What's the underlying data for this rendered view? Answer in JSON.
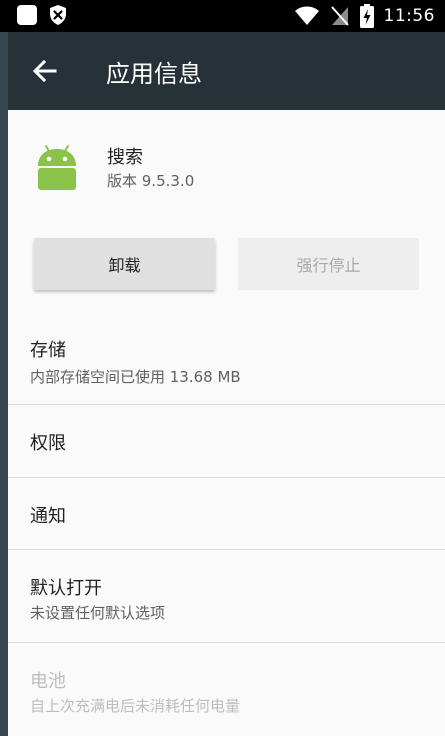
{
  "status_bar": {
    "time": "11:56",
    "icons": [
      "notification-square-icon",
      "shield-x-icon",
      "wifi-icon",
      "no-sim-icon",
      "battery-charging-icon"
    ]
  },
  "toolbar": {
    "back_icon": "arrow-back-icon",
    "title": "应用信息"
  },
  "app": {
    "icon": "android-icon",
    "name": "搜索",
    "version": "版本 9.5.3.0"
  },
  "buttons": {
    "uninstall": "卸载",
    "force_stop": "强行停止"
  },
  "items": [
    {
      "title": "存储",
      "subtitle": "内部存储空间已使用 13.68 MB",
      "enabled": true
    },
    {
      "title": "权限",
      "enabled": true
    },
    {
      "title": "通知",
      "enabled": true
    },
    {
      "title": "默认打开",
      "subtitle": "未设置任何默认选项",
      "enabled": true
    },
    {
      "title": "电池",
      "subtitle": "自上次充满电后未消耗任何电量",
      "enabled": false
    }
  ],
  "colors": {
    "toolbar": "#263238",
    "background": "#fafafa",
    "android_green": "#8bc34a"
  }
}
